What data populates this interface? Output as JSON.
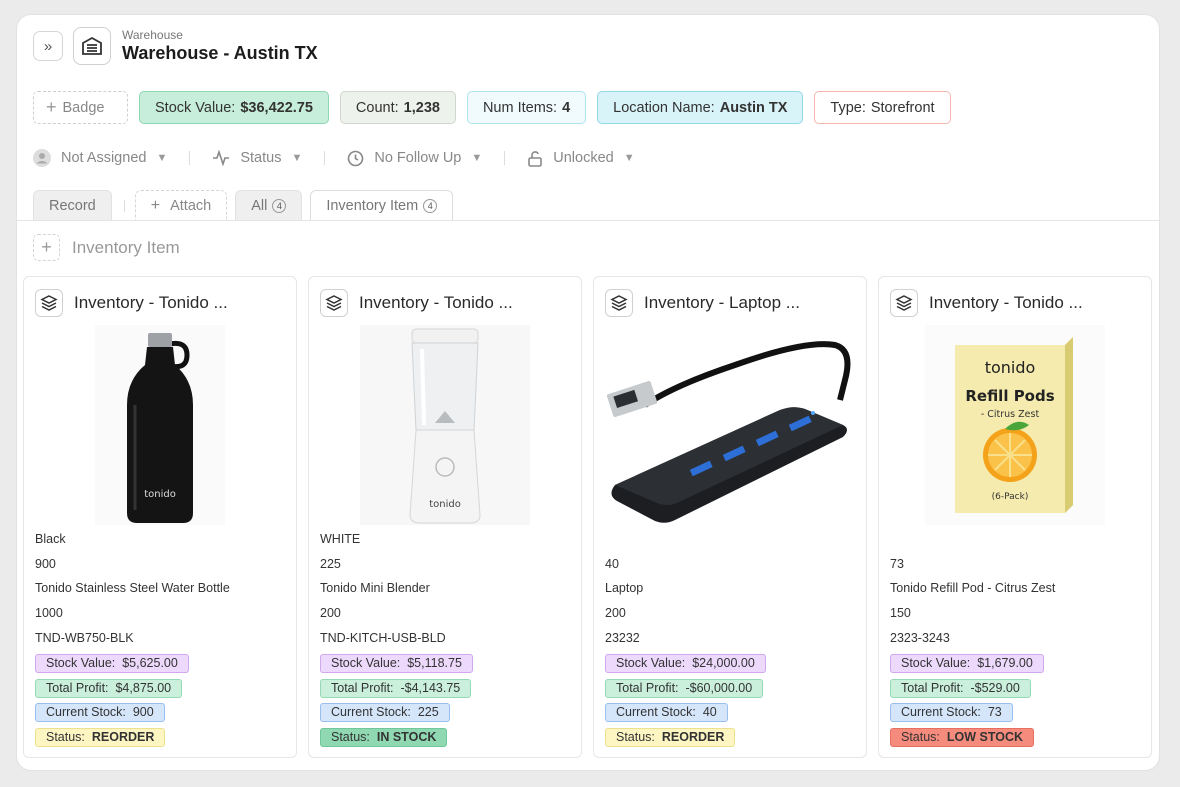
{
  "header": {
    "breadcrumb": "Warehouse",
    "title": "Warehouse - Austin TX",
    "expand_glyph": "»"
  },
  "badges": {
    "add_label": "Badge",
    "items": [
      {
        "label": "Stock Value:",
        "value": "$36,422.75"
      },
      {
        "label": "Count:",
        "value": "1,238"
      },
      {
        "label": "Num Items:",
        "value": "4"
      },
      {
        "label": "Location Name:",
        "value": "Austin TX"
      },
      {
        "label": "Type:",
        "value": "Storefront"
      }
    ]
  },
  "filters": {
    "assignee": "Not Assigned",
    "status": "Status",
    "follow_up": "No Follow Up",
    "lock": "Unlocked"
  },
  "tabs": {
    "record": "Record",
    "attach": "Attach",
    "all": "All",
    "all_count": "4",
    "inventory_item": "Inventory Item",
    "inventory_item_count": "4"
  },
  "section": {
    "title": "Inventory Item"
  },
  "cards": [
    {
      "title": "Inventory - Tonido ...",
      "image": "black-water-bottle",
      "lines": [
        "Black",
        "900",
        "Tonido Stainless Steel Water Bottle",
        "1000",
        "TND-WB750-BLK"
      ],
      "stock_value": "$5,625.00",
      "total_profit": "$4,875.00",
      "current_stock": "900",
      "status": "REORDER"
    },
    {
      "title": "Inventory - Tonido ...",
      "image": "white-mini-blender",
      "lines": [
        "WHITE",
        "225",
        "Tonido Mini Blender",
        "200",
        "TND-KITCH-USB-BLD"
      ],
      "stock_value": "$5,118.75",
      "total_profit": "-$4,143.75",
      "current_stock": "225",
      "status": "IN STOCK"
    },
    {
      "title": "Inventory - Laptop ...",
      "image": "usb-hub",
      "lines": [
        "40",
        "Laptop",
        "200",
        "23232"
      ],
      "stock_value": "$24,000.00",
      "total_profit": "-$60,000.00",
      "current_stock": "40",
      "status": "REORDER"
    },
    {
      "title": "Inventory - Tonido ...",
      "image": "refill-pods-box",
      "lines": [
        "73",
        "Tonido Refill Pod - Citrus Zest",
        "150",
        "2323-3243"
      ],
      "stock_value": "$1,679.00",
      "total_profit": "-$529.00",
      "current_stock": "73",
      "status": "LOW STOCK"
    }
  ],
  "labels": {
    "stock_value": "Stock Value:",
    "total_profit": "Total Profit:",
    "current_stock": "Current Stock:",
    "status": "Status:"
  },
  "product_text": {
    "bottle_brand": "tonido",
    "blender_brand": "tonido",
    "box_brand": "tonido",
    "box_title": "Refill Pods",
    "box_subtitle": "- Citrus Zest",
    "box_pack": "(6-Pack)"
  },
  "colors": {
    "status_reorder": "#fdf6c3",
    "status_in_stock": "#8fd8b2",
    "status_low_stock": "#f58b7d",
    "stock_value_badge": "#c7eedb"
  }
}
